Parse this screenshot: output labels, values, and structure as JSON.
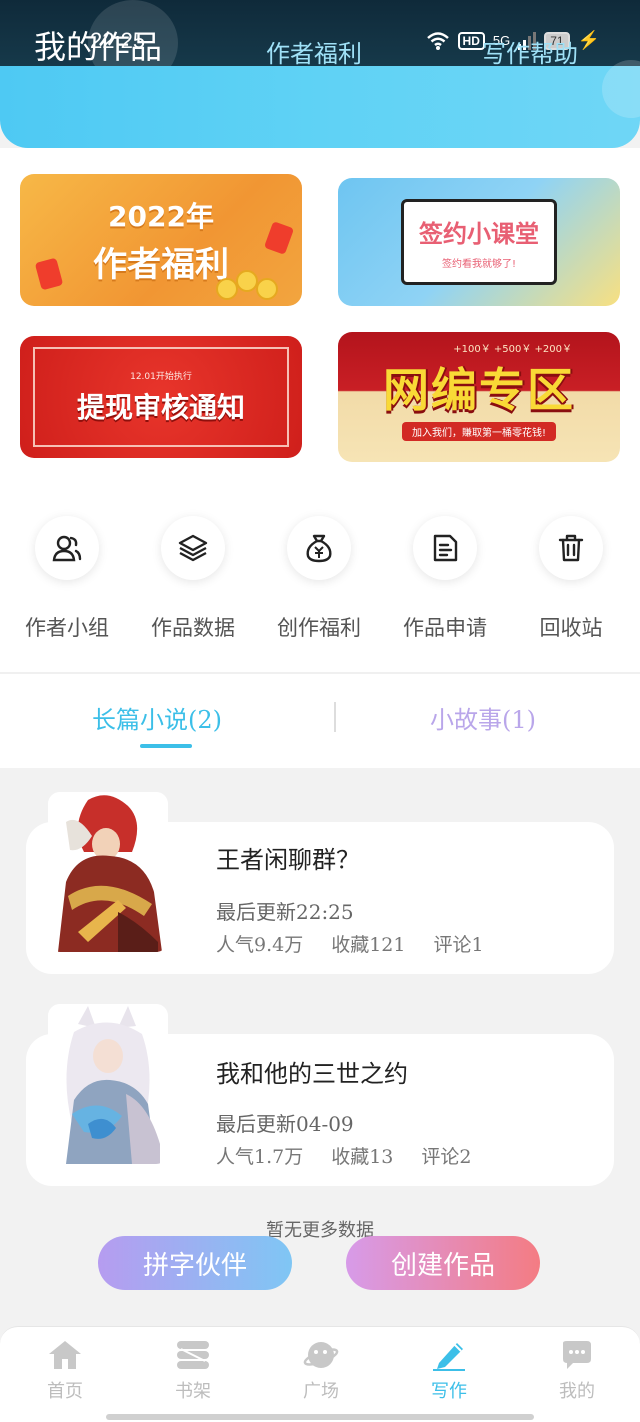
{
  "status_bar": {
    "time": "22:25",
    "hd": "HD",
    "network": "5G",
    "battery": "71"
  },
  "header": {
    "tabs": [
      {
        "label": "我的作品",
        "active": true
      },
      {
        "label": "作者福利",
        "active": false
      },
      {
        "label": "写作帮助",
        "active": false
      }
    ]
  },
  "banners": {
    "welfare": {
      "year": "2022年",
      "title": "作者福利"
    },
    "course": {
      "title": "签约小课堂",
      "subtitle": "签约看我就够了!"
    },
    "notice": {
      "small": "12.01开始执行",
      "title": "提现审核通知"
    },
    "web": {
      "title": "网编专区",
      "strip": "加入我们，賺取第一桶零花钱!",
      "prices": "+100￥  +500￥  +200￥"
    }
  },
  "features": [
    {
      "label": "作者小组",
      "icon": "users-icon"
    },
    {
      "label": "作品数据",
      "icon": "layers-icon"
    },
    {
      "label": "创作福利",
      "icon": "money-bag-icon"
    },
    {
      "label": "作品申请",
      "icon": "document-icon"
    },
    {
      "label": "回收站",
      "icon": "trash-icon"
    }
  ],
  "categories": {
    "novel": "长篇小说(2)",
    "story": "小故事(1)"
  },
  "works": [
    {
      "title": "王者闲聊群？",
      "updated": "最后更新22:25",
      "popularity": "人气9.4万",
      "favorites": "收藏121",
      "comments": "评论1"
    },
    {
      "title": "我和他的三世之约",
      "updated": "最后更新04-09",
      "popularity": "人气1.7万",
      "favorites": "收藏13",
      "comments": "评论2"
    }
  ],
  "no_more": "暂无更多数据",
  "actions": {
    "partner": "拼字伙伴",
    "create": "创建作品"
  },
  "nav": [
    {
      "label": "首页",
      "icon": "home-icon"
    },
    {
      "label": "书架",
      "icon": "bookshelf-icon"
    },
    {
      "label": "广场",
      "icon": "planet-icon"
    },
    {
      "label": "写作",
      "icon": "pen-icon",
      "active": true
    },
    {
      "label": "我的",
      "icon": "chat-icon"
    }
  ],
  "colors": {
    "accent": "#3cbfe8",
    "header": "#4ec9f3",
    "secondary_tab": "#b9a6ea"
  }
}
